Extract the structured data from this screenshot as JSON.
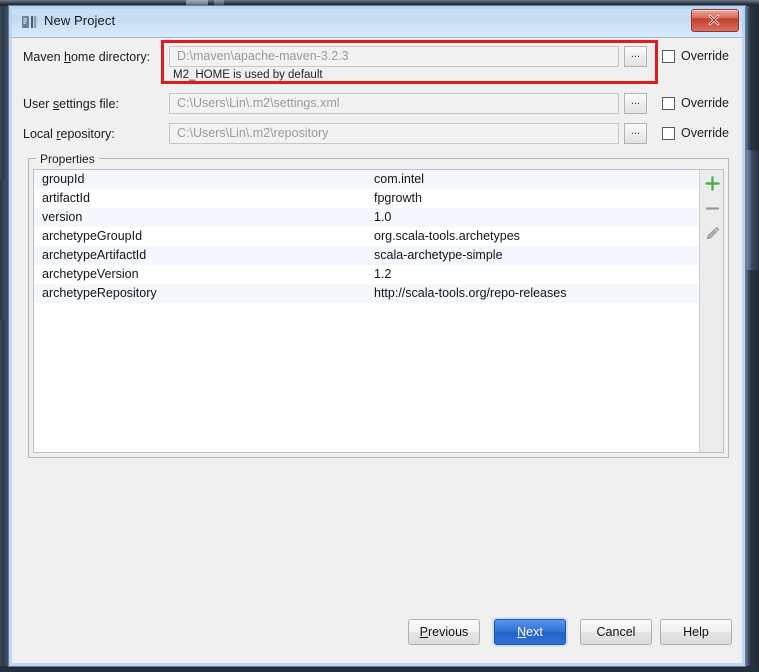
{
  "window": {
    "title": "New Project",
    "icon": "idea-module-icon",
    "close_label": "close-window"
  },
  "form": {
    "rows": [
      {
        "label_prefix": "Maven ",
        "label_mnemonic": "h",
        "label_suffix": "ome directory:",
        "value": "D:\\maven\\apache-maven-3.2.3",
        "browse_label": "...",
        "override_label": "Override",
        "override_checked": false,
        "hint": "M2_HOME is used by default"
      },
      {
        "label_prefix": "User ",
        "label_mnemonic": "s",
        "label_suffix": "ettings file:",
        "value": "C:\\Users\\Lin\\.m2\\settings.xml",
        "browse_label": "...",
        "override_label": "Override",
        "override_checked": false,
        "hint": ""
      },
      {
        "label_prefix": "Local ",
        "label_mnemonic": "r",
        "label_suffix": "epository:",
        "value": "C:\\Users\\Lin\\.m2\\repository",
        "browse_label": "...",
        "override_label": "Override",
        "override_checked": false,
        "hint": ""
      }
    ]
  },
  "annotation": {
    "color": "#e01b1b",
    "target": "maven-home-directory-row"
  },
  "properties": {
    "legend": "Properties",
    "rows": [
      {
        "key": "groupId",
        "value": "com.intel"
      },
      {
        "key": "artifactId",
        "value": "fpgrowth"
      },
      {
        "key": "version",
        "value": "1.0"
      },
      {
        "key": "archetypeGroupId",
        "value": "org.scala-tools.archetypes"
      },
      {
        "key": "archetypeArtifactId",
        "value": "scala-archetype-simple"
      },
      {
        "key": "archetypeVersion",
        "value": "1.2"
      },
      {
        "key": "archetypeRepository",
        "value": "http://scala-tools.org/repo-releases"
      }
    ],
    "toolbar": [
      {
        "name": "add-property-button",
        "icon": "plus-icon",
        "color": "#4caf50"
      },
      {
        "name": "remove-property-button",
        "icon": "minus-icon",
        "color": "#8a8a8a"
      },
      {
        "name": "edit-property-button",
        "icon": "pencil-icon",
        "color": "#9a9a9a"
      }
    ]
  },
  "footer": {
    "buttons": [
      {
        "prefix": "",
        "mnemonic": "P",
        "suffix": "revious",
        "primary": false
      },
      {
        "prefix": "",
        "mnemonic": "N",
        "suffix": "ext",
        "primary": true
      },
      {
        "prefix": "Cancel",
        "mnemonic": "",
        "suffix": "",
        "primary": false
      },
      {
        "prefix": "Help",
        "mnemonic": "",
        "suffix": "",
        "primary": false
      }
    ]
  }
}
